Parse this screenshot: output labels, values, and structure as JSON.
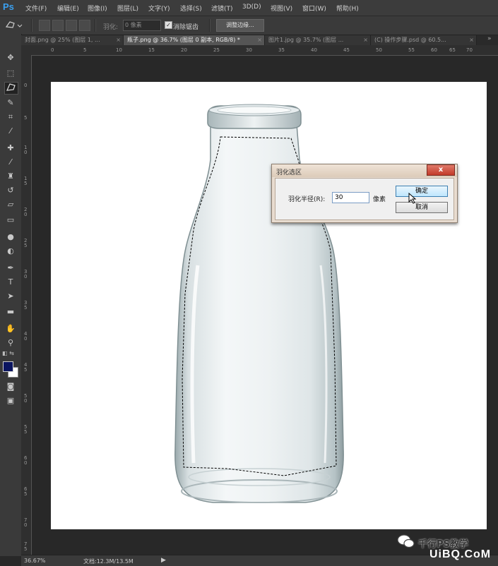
{
  "app": {
    "logo": "Ps"
  },
  "menu": [
    "文件(F)",
    "编辑(E)",
    "图像(I)",
    "图层(L)",
    "文字(Y)",
    "选择(S)",
    "滤镜(T)",
    "3D(D)",
    "视图(V)",
    "窗口(W)",
    "帮助(H)"
  ],
  "options": {
    "feather_label": "羽化:",
    "feather_value": "0 像素",
    "antialias_label": "消除锯齿",
    "antialias_checked": true,
    "refine_label": "调整边缘..."
  },
  "tabs": [
    {
      "label": "封面.png @ 25% (图层 1, ...",
      "active": false
    },
    {
      "label": "瓶子.png @ 36.7% (图层 0 副本, RGB/8) *",
      "active": true
    },
    {
      "label": "图片1.jpg @ 35.7% (图层 ...",
      "active": false
    },
    {
      "label": "(C) 操作步骤.psd @ 60.5...",
      "active": false
    }
  ],
  "ruler": {
    "h_ticks": [
      "0",
      "5",
      "10",
      "15",
      "20",
      "25",
      "30",
      "35",
      "40",
      "45",
      "50",
      "55",
      "60",
      "65",
      "70"
    ],
    "v_ticks": [
      "0",
      "5",
      "1 0",
      "1 5",
      "2 0",
      "2 5",
      "3 0",
      "3 5",
      "4 0",
      "4 5",
      "5 0",
      "5 5",
      "6 0",
      "6 5",
      "7 0",
      "7 5"
    ]
  },
  "tools": [
    "move-icon",
    "marquee-icon",
    "lasso-icon",
    "quick-select-icon",
    "crop-icon",
    "eyedropper-icon",
    "healing-icon",
    "brush-icon",
    "stamp-icon",
    "history-brush-icon",
    "eraser-icon",
    "gradient-icon",
    "blur-icon",
    "dodge-icon",
    "pen-icon",
    "type-icon",
    "path-select-icon",
    "shape-icon",
    "hand-icon",
    "zoom-icon"
  ],
  "colors": {
    "foreground": "#0b1560",
    "background": "#ffffff",
    "accent": "#3aa0f0"
  },
  "dialog": {
    "title": "羽化选区",
    "close": "x",
    "radius_label": "羽化半径(R):",
    "radius_value": "30",
    "unit": "像素",
    "ok": "确定",
    "cancel": "取消"
  },
  "status": {
    "zoom": "36.67%",
    "doc": "文档:12.3M/13.5M"
  },
  "watermark": {
    "text": "千行PS教学",
    "brand": "UiBQ.CoM"
  }
}
